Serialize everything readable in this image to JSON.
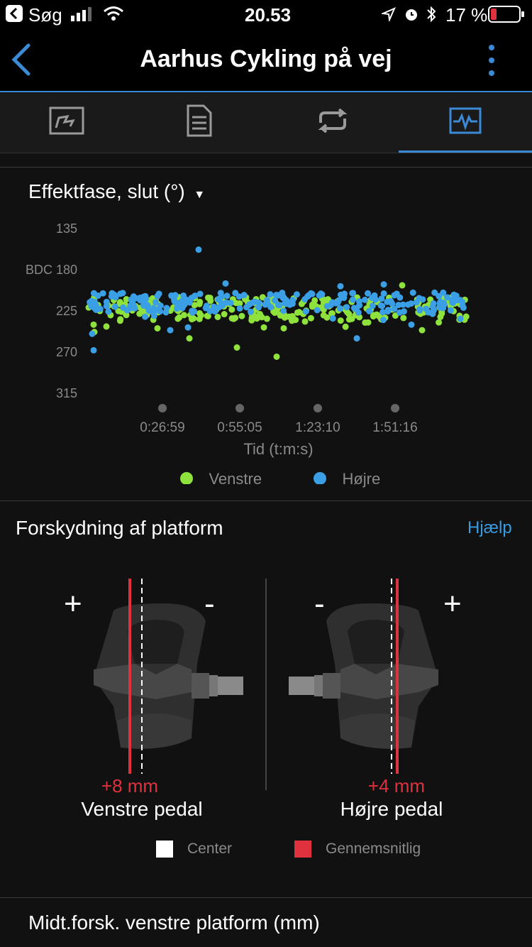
{
  "status_bar": {
    "back_app": "Søg",
    "time": "20.53",
    "battery": "17 %"
  },
  "nav": {
    "title": "Aarhus Cykling på vej"
  },
  "tabs": [
    {
      "icon": "chart-flag-icon",
      "active": false
    },
    {
      "icon": "document-list-icon",
      "active": false
    },
    {
      "icon": "repeat-loop-icon",
      "active": false
    },
    {
      "icon": "activity-graph-icon",
      "active": true
    }
  ],
  "chart_section": {
    "metric_title": "Effektfase, slut (°)",
    "y_ticks": [
      "135",
      "BDC 180",
      "225",
      "270",
      "315"
    ],
    "x_ticks": [
      "0:26:59",
      "0:55:05",
      "1:23:10",
      "1:51:16"
    ],
    "x_label": "Tid (t:m:s)",
    "legend_left": "Venstre",
    "legend_right": "Højre",
    "colors": {
      "left": "#8fe13c",
      "right": "#3b9fe6"
    }
  },
  "chart_data": {
    "type": "scatter",
    "x_ticks": [
      "0:26:59",
      "0:55:05",
      "1:23:10",
      "1:51:16"
    ],
    "xlabel": "Tid (t:m:s)",
    "ylabel": "",
    "ylim": [
      315,
      135
    ],
    "y_ticks": [
      135,
      180,
      225,
      270,
      315
    ],
    "series": [
      {
        "name": "Venstre",
        "description_values": {
          "typical_range": [
            205,
            235
          ],
          "outliers": [
            210,
            255,
            265,
            275
          ]
        }
      },
      {
        "name": "Højre",
        "description_values": {
          "typical_range": [
            205,
            230
          ],
          "outliers": [
            158,
            195,
            250,
            258
          ]
        }
      }
    ]
  },
  "platform_section": {
    "title": "Forskydning af platform",
    "help": "Hjælp",
    "left_plus": "+",
    "left_minus": "-",
    "right_minus": "-",
    "right_plus": "+",
    "left_value": "+8 mm",
    "left_label": "Venstre pedal",
    "right_value": "+4 mm",
    "right_label": "Højre pedal",
    "legend_center": "Center",
    "legend_average": "Gennemsnitlig"
  },
  "bottom": {
    "title": "Midt.forsk. venstre platform (mm)"
  }
}
